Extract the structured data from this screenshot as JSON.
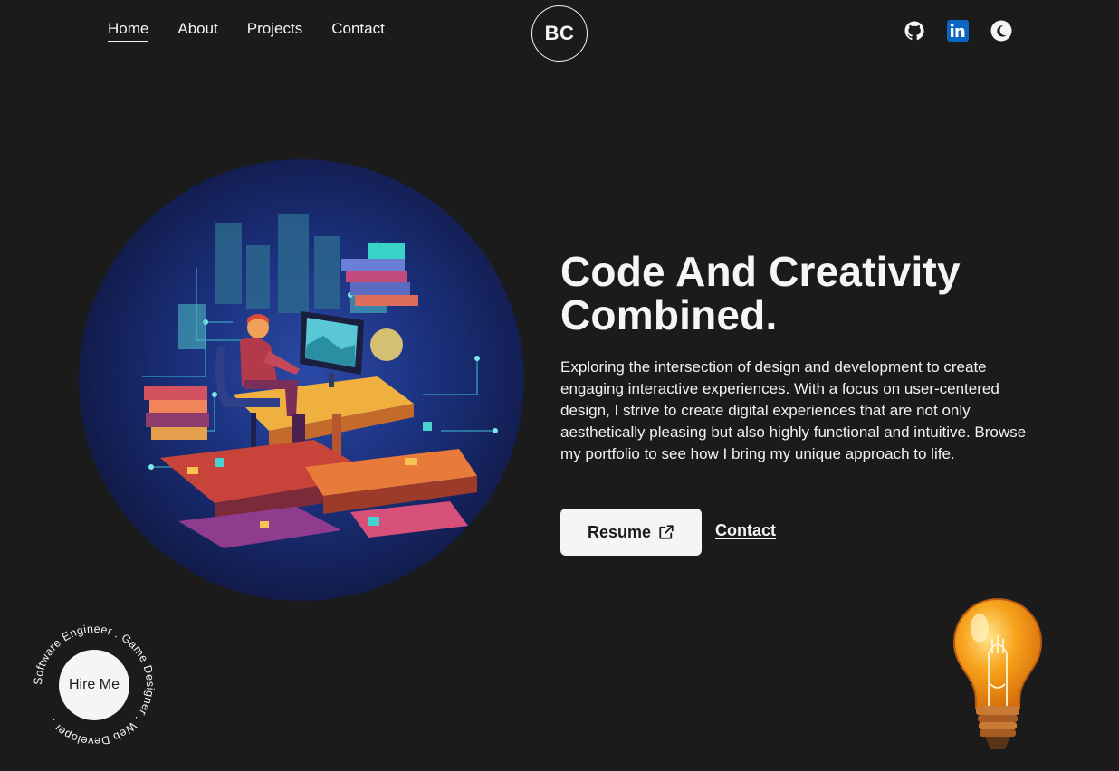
{
  "nav": {
    "links": [
      "Home",
      "About",
      "Projects",
      "Contact"
    ],
    "active": "Home",
    "logo_text": "BC"
  },
  "socials": [
    "github-icon",
    "linkedin-icon",
    "theme-toggle-moon-icon"
  ],
  "hero": {
    "headline": "Code And Creativity Combined.",
    "description": "Exploring the intersection of design and development to create engaging interactive experiences. With a focus on user-centered design, I strive to create digital experiences that are not only aesthetically pleasing but also highly functional and intuitive. Browse my portfolio to see how I bring my unique approach to life.",
    "resume_label": "Resume",
    "contact_label": "Contact"
  },
  "hire": {
    "label": "Hire Me",
    "ring_text": "Software Engineer . Game Designer . Web Developer ."
  },
  "colors": {
    "background": "#1b1b1b",
    "text": "#f5f5f5",
    "linkedin": "#0a66c2",
    "bulb": "#f7a21b"
  }
}
